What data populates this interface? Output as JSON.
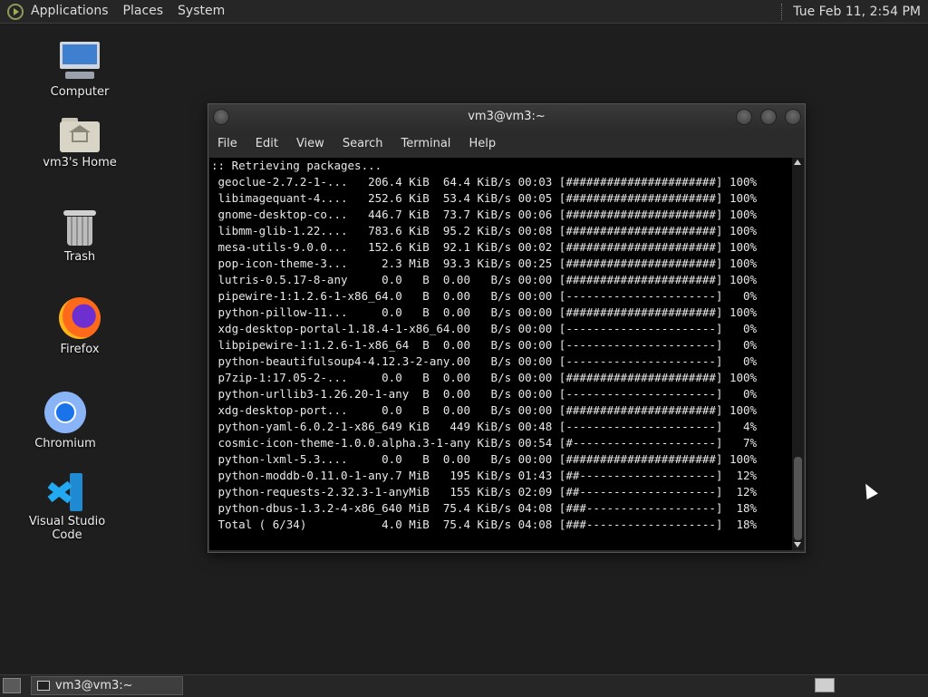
{
  "top_panel": {
    "menus": [
      "Applications",
      "Places",
      "System"
    ],
    "clock": "Tue Feb 11,  2:54 PM"
  },
  "desktop_icons": [
    {
      "label": "Computer",
      "icon": "computer-icon"
    },
    {
      "label": "vm3's Home",
      "icon": "home-folder-icon"
    },
    {
      "label": "Trash",
      "icon": "trash-icon"
    },
    {
      "label": "Firefox",
      "icon": "firefox-icon"
    },
    {
      "label": "Chromium",
      "icon": "chromium-icon"
    },
    {
      "label": "Visual Studio Code",
      "icon": "vscode-icon"
    }
  ],
  "terminal": {
    "title": "vm3@vm3:~",
    "menu": [
      "File",
      "Edit",
      "View",
      "Search",
      "Terminal",
      "Help"
    ],
    "lines": [
      ":: Retrieving packages...",
      " geoclue-2.7.2-1-...   206.4 KiB  64.4 KiB/s 00:03 [######################] 100%",
      " libimagequant-4....   252.6 KiB  53.4 KiB/s 00:05 [######################] 100%",
      " gnome-desktop-co...   446.7 KiB  73.7 KiB/s 00:06 [######################] 100%",
      " libmm-glib-1.22....   783.6 KiB  95.2 KiB/s 00:08 [######################] 100%",
      " mesa-utils-9.0.0...   152.6 KiB  92.1 KiB/s 00:02 [######################] 100%",
      " pop-icon-theme-3...     2.3 MiB  93.3 KiB/s 00:25 [######################] 100%",
      " lutris-0.5.17-8-any     0.0   B  0.00   B/s 00:00 [######################] 100%",
      " pipewire-1:1.2.6-1-x86_64.0   B  0.00   B/s 00:00 [----------------------]   0%",
      " python-pillow-11...     0.0   B  0.00   B/s 00:00 [######################] 100%",
      " xdg-desktop-portal-1.18.4-1-x86_64.00   B/s 00:00 [----------------------]   0%",
      " libpipewire-1:1.2.6-1-x86_64  B  0.00   B/s 00:00 [----------------------]   0%",
      " python-beautifulsoup4-4.12.3-2-any.00   B/s 00:00 [----------------------]   0%",
      " p7zip-1:17.05-2-...     0.0   B  0.00   B/s 00:00 [######################] 100%",
      " python-urllib3-1.26.20-1-any  B  0.00   B/s 00:00 [----------------------]   0%",
      " xdg-desktop-port...     0.0   B  0.00   B/s 00:00 [######################] 100%",
      " python-yaml-6.0.2-1-x86_649 KiB   449 KiB/s 00:48 [----------------------]   4%",
      " cosmic-icon-theme-1.0.0.alpha.3-1-any KiB/s 00:54 [#---------------------]   7%",
      " python-lxml-5.3....     0.0   B  0.00   B/s 00:00 [######################] 100%",
      " python-moddb-0.11.0-1-any.7 MiB   195 KiB/s 01:43 [##--------------------]  12%",
      " python-requests-2.32.3-1-anyMiB   155 KiB/s 02:09 [##--------------------]  12%",
      " python-dbus-1.3.2-4-x86_640 MiB  75.4 KiB/s 04:08 [###-------------------]  18%",
      " Total ( 6/34)           4.0 MiB  75.4 KiB/s 04:08 [###-------------------]  18%"
    ]
  },
  "taskbar": {
    "task_label": "vm3@vm3:~"
  }
}
